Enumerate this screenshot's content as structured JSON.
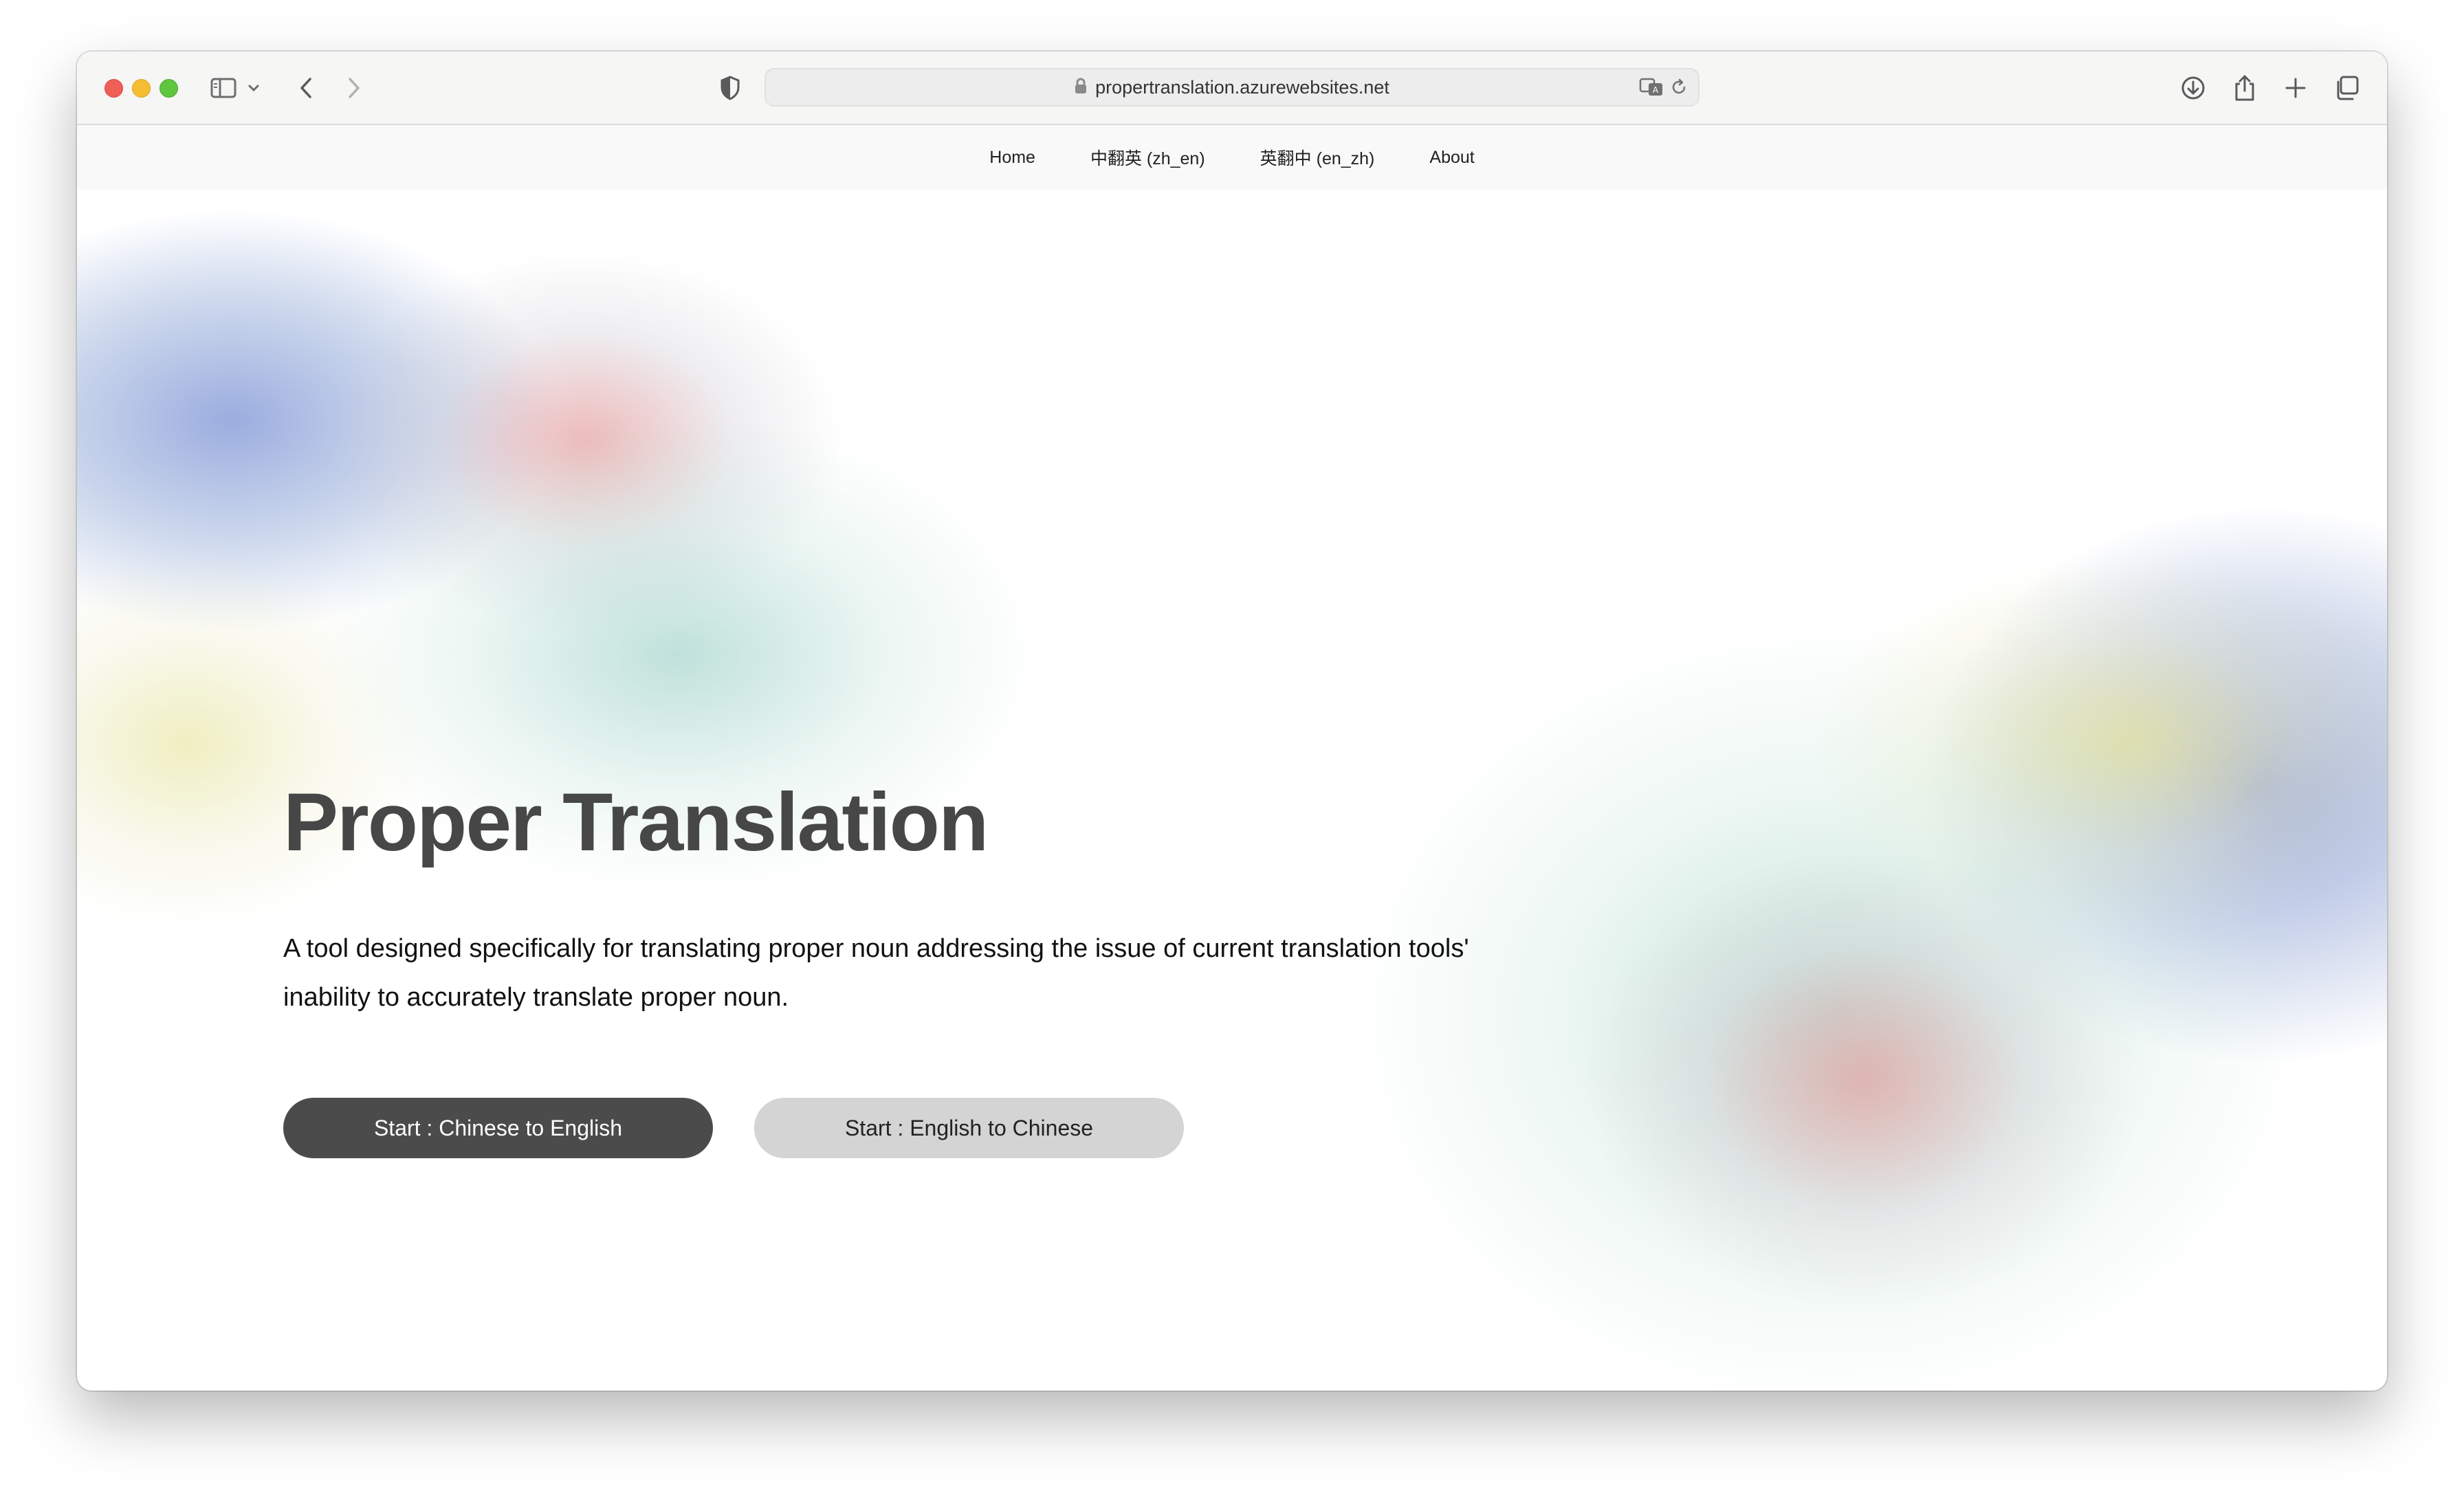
{
  "browser": {
    "url": "propertranslation.azurewebsites.net",
    "icons": [
      "sidebar-icon",
      "chevron-down-icon",
      "back-icon",
      "forward-icon",
      "privacy-shield-icon",
      "lock-icon",
      "translate-icon",
      "reload-icon",
      "download-icon",
      "share-icon",
      "new-tab-icon",
      "tab-overview-icon"
    ]
  },
  "nav": {
    "items": [
      {
        "label": "Home"
      },
      {
        "label": "中翻英 (zh_en)"
      },
      {
        "label": "英翻中 (en_zh)"
      },
      {
        "label": "About"
      }
    ]
  },
  "hero": {
    "title": "Proper Translation",
    "description": "A tool designed specifically for translating proper noun addressing the issue of current translation tools' inability to accurately translate proper noun.",
    "primary_button": "Start : Chinese to English",
    "secondary_button": "Start : English to Chinese"
  },
  "colors": {
    "title": "#474747",
    "primary_button": "#4b4b4b",
    "secondary_button": "#d4d4d4"
  }
}
